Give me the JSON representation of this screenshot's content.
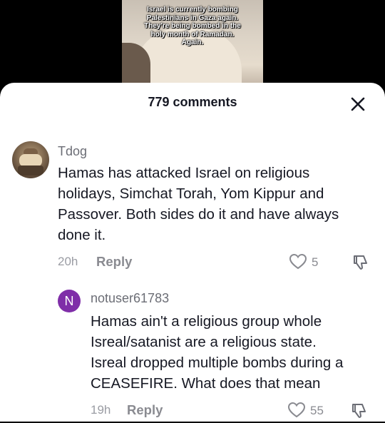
{
  "video": {
    "caption": "Israel is currently bombing\nPalestinians in Gaza again.\nThey're being bombed in the\nholy month of Ramadan.\nAgain."
  },
  "sheet": {
    "comments_count": "779 comments",
    "close_icon": "close-icon"
  },
  "comments": [
    {
      "username": "Tdog",
      "text": "Hamas has attacked Israel on religious\nholidays, Simchat Torah, Yom Kippur and\nPassover. Both sides do it and have always\ndone it.",
      "time": "20h",
      "reply_label": "Reply",
      "likes": "5"
    },
    {
      "avatar_letter": "N",
      "avatar_color": "#7f2ea8",
      "username": "notuser61783",
      "text": "Hamas ain't a religious group whole\nIsreal/satanist are a religious state.\nIsreal dropped multiple bombs during a\nCEASEFIRE. What does that mean",
      "time": "19h",
      "reply_label": "Reply",
      "likes": "55"
    }
  ]
}
